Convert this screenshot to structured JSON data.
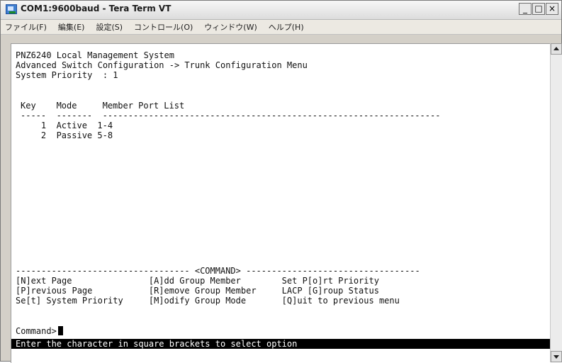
{
  "window": {
    "title": "COM1:9600baud - Tera Term VT",
    "minimize": "_",
    "maximize": "□",
    "close": "×"
  },
  "menu": [
    "ファイル(F)",
    "編集(E)",
    "設定(S)",
    "コントロール(O)",
    "ウィンドウ(W)",
    "ヘルプ(H)"
  ],
  "terminal": {
    "header_line1": "PNZ6240 Local Management System",
    "header_line2": "Advanced Switch Configuration -> Trunk Configuration Menu",
    "system_priority": "System Priority  : 1",
    "table_header": "Key    Mode     Member Port List",
    "separator": "-----  -------  ------------------------------------------------------------------",
    "rows": [
      "    1  Active  1-4",
      "    2  Passive 5-8"
    ],
    "command_divider": "---------------------------------- <COMMAND> ----------------------------------",
    "commands": [
      "[N]ext Page               [A]dd Group Member        Set P[o]rt Priority",
      "[P]revious Page           [R]emove Group Member     LACP [G]roup Status",
      "Se[t] System Priority     [M]odify Group Mode       [Q]uit to previous menu"
    ],
    "prompt": "Command>",
    "status": "Enter the character in square brackets to select option"
  }
}
